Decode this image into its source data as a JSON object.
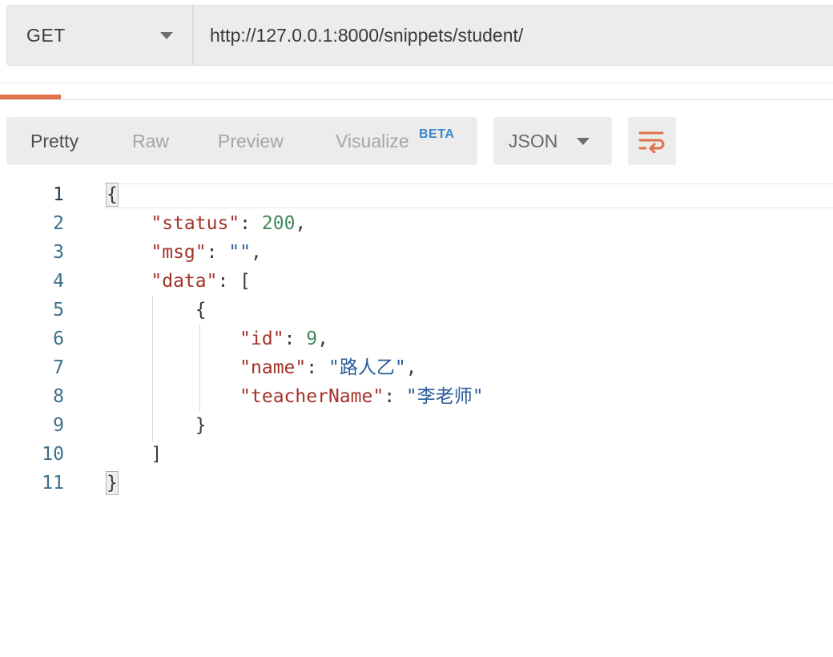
{
  "request": {
    "method": "GET",
    "url": "http://127.0.0.1:8000/snippets/student/"
  },
  "response_toolbar": {
    "tabs": [
      "Pretty",
      "Raw",
      "Preview",
      "Visualize"
    ],
    "active_tab": "Pretty",
    "beta_badge": "BETA",
    "format": "JSON"
  },
  "colors": {
    "accent": "#e0714a",
    "key": "#a3322a",
    "number": "#3f8a5e",
    "string": "#2a5c98",
    "line_number": "#3d6f8c",
    "beta": "#3c88c8"
  },
  "icons": {
    "method_caret": "chevron-down-icon",
    "format_caret": "chevron-down-icon",
    "wrap": "wrap-lines-icon"
  },
  "code": {
    "line_numbers": [
      "1",
      "2",
      "3",
      "4",
      "5",
      "6",
      "7",
      "8",
      "9",
      "10",
      "11"
    ],
    "lines": [
      {
        "indent": "",
        "tokens": [
          {
            "t": "punc",
            "v": "{"
          }
        ],
        "match": true
      },
      {
        "indent": "    ",
        "tokens": [
          {
            "t": "key",
            "v": "\"status\""
          },
          {
            "t": "punc",
            "v": ": "
          },
          {
            "t": "num",
            "v": "200"
          },
          {
            "t": "punc",
            "v": ","
          }
        ]
      },
      {
        "indent": "    ",
        "tokens": [
          {
            "t": "key",
            "v": "\"msg\""
          },
          {
            "t": "punc",
            "v": ": "
          },
          {
            "t": "str",
            "v": "\"\""
          },
          {
            "t": "punc",
            "v": ","
          }
        ]
      },
      {
        "indent": "    ",
        "tokens": [
          {
            "t": "key",
            "v": "\"data\""
          },
          {
            "t": "punc",
            "v": ": ["
          }
        ]
      },
      {
        "indent": "        ",
        "tokens": [
          {
            "t": "punc",
            "v": "{"
          }
        ]
      },
      {
        "indent": "            ",
        "tokens": [
          {
            "t": "key",
            "v": "\"id\""
          },
          {
            "t": "punc",
            "v": ": "
          },
          {
            "t": "num",
            "v": "9"
          },
          {
            "t": "punc",
            "v": ","
          }
        ]
      },
      {
        "indent": "            ",
        "tokens": [
          {
            "t": "key",
            "v": "\"name\""
          },
          {
            "t": "punc",
            "v": ": "
          },
          {
            "t": "str",
            "v": "\"路人乙\""
          },
          {
            "t": "punc",
            "v": ","
          }
        ]
      },
      {
        "indent": "            ",
        "tokens": [
          {
            "t": "key",
            "v": "\"teacherName\""
          },
          {
            "t": "punc",
            "v": ": "
          },
          {
            "t": "str",
            "v": "\"李老师\""
          }
        ]
      },
      {
        "indent": "        ",
        "tokens": [
          {
            "t": "punc",
            "v": "}"
          }
        ]
      },
      {
        "indent": "    ",
        "tokens": [
          {
            "t": "punc",
            "v": "]"
          }
        ]
      },
      {
        "indent": "",
        "tokens": [
          {
            "t": "punc",
            "v": "}"
          }
        ],
        "match": true
      }
    ]
  }
}
